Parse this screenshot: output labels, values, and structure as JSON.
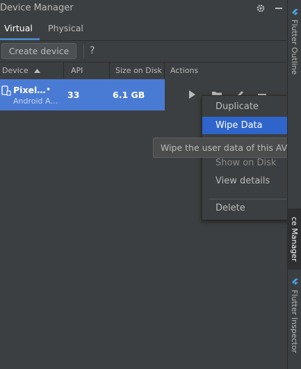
{
  "window": {
    "title": "Device Manager",
    "settings_icon": "gear-icon",
    "hide_icon": "minimize-icon"
  },
  "tabs": [
    {
      "label": "Virtual",
      "active": true
    },
    {
      "label": "Physical",
      "active": false
    }
  ],
  "toolbar": {
    "create_label": "Create device",
    "help_label": "?"
  },
  "table": {
    "columns": [
      "Device",
      "API",
      "Size on Disk",
      "Actions"
    ],
    "sort_column": "Device",
    "rows": [
      {
        "name": "Pixel…",
        "status_dot": "•",
        "subtitle": "Android A…",
        "api": "33",
        "size": "6.1 GB",
        "selected": true
      }
    ]
  },
  "context_menu": {
    "items": [
      {
        "label": "Duplicate",
        "state": "normal"
      },
      {
        "label": "Wipe Data",
        "state": "selected"
      },
      {
        "label": "Show on Disk",
        "state": "dim"
      },
      {
        "label": "View details",
        "state": "normal"
      },
      {
        "label": "Delete",
        "state": "normal"
      }
    ]
  },
  "tooltip": {
    "text": "Wipe the user data of this AVD"
  },
  "right_strip": {
    "tabs": [
      {
        "label": "Flutter Outline",
        "icon": "flutter-icon"
      },
      {
        "label": "ce Manager",
        "active": true
      },
      {
        "label": "Flutter Inspector",
        "icon": "flutter-icon"
      }
    ]
  },
  "colors": {
    "background": "#3c3f41",
    "selection": "#4a7bd4",
    "menu_selection": "#2f65ca",
    "accent_underline": "#4a88c7",
    "flutter_blue": "#44a8e8"
  }
}
